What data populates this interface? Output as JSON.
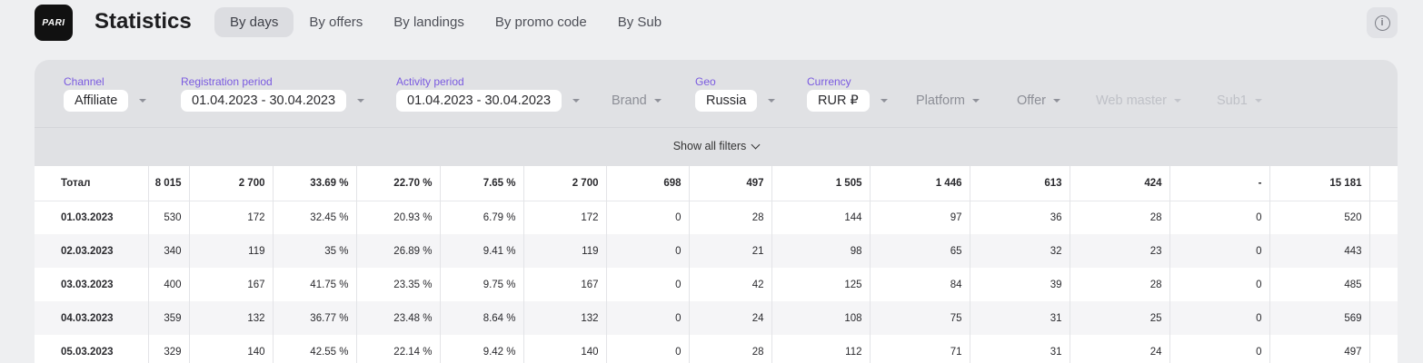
{
  "app": {
    "logo_text": "PARI",
    "title": "Statistics"
  },
  "tabs": [
    {
      "label": "By days",
      "active": true
    },
    {
      "label": "By offers",
      "active": false
    },
    {
      "label": "By landings",
      "active": false
    },
    {
      "label": "By promo code",
      "active": false
    },
    {
      "label": "By Sub",
      "active": false
    }
  ],
  "info_icon": "info-icon",
  "filters": {
    "channel": {
      "label": "Channel",
      "value": "Affiliate"
    },
    "registration_period": {
      "label": "Registration period",
      "value": "01.04.2023 - 30.04.2023"
    },
    "activity_period": {
      "label": "Activity period",
      "value": "01.04.2023 - 30.04.2023"
    },
    "brand": {
      "value": "Brand"
    },
    "geo": {
      "label": "Geo",
      "value": "Russia"
    },
    "currency": {
      "label": "Currency",
      "value": "RUR ₽"
    },
    "platform": {
      "value": "Platform"
    },
    "offer": {
      "value": "Offer"
    },
    "web_master": {
      "value": "Web master"
    },
    "sub1": {
      "value": "Sub1"
    },
    "show_all": "Show all filters"
  },
  "table": {
    "rows": [
      [
        "Тотал",
        "8 015",
        "2 700",
        "33.69 %",
        "22.70 %",
        "7.65 %",
        "2 700",
        "698",
        "497",
        "1 505",
        "1 446",
        "613",
        "424",
        "-",
        "15 181",
        ""
      ],
      [
        "01.03.2023",
        "530",
        "172",
        "32.45 %",
        "20.93 %",
        "6.79 %",
        "172",
        "0",
        "28",
        "144",
        "97",
        "36",
        "28",
        "0",
        "520",
        ""
      ],
      [
        "02.03.2023",
        "340",
        "119",
        "35 %",
        "26.89 %",
        "9.41 %",
        "119",
        "0",
        "21",
        "98",
        "65",
        "32",
        "23",
        "0",
        "443",
        ""
      ],
      [
        "03.03.2023",
        "400",
        "167",
        "41.75 %",
        "23.35 %",
        "9.75 %",
        "167",
        "0",
        "42",
        "125",
        "84",
        "39",
        "28",
        "0",
        "485",
        ""
      ],
      [
        "04.03.2023",
        "359",
        "132",
        "36.77 %",
        "23.48 %",
        "8.64 %",
        "132",
        "0",
        "24",
        "108",
        "75",
        "31",
        "25",
        "0",
        "569",
        ""
      ],
      [
        "05.03.2023",
        "329",
        "140",
        "42.55 %",
        "22.14 %",
        "9.42 %",
        "140",
        "0",
        "28",
        "112",
        "71",
        "31",
        "24",
        "0",
        "497",
        ""
      ]
    ]
  }
}
